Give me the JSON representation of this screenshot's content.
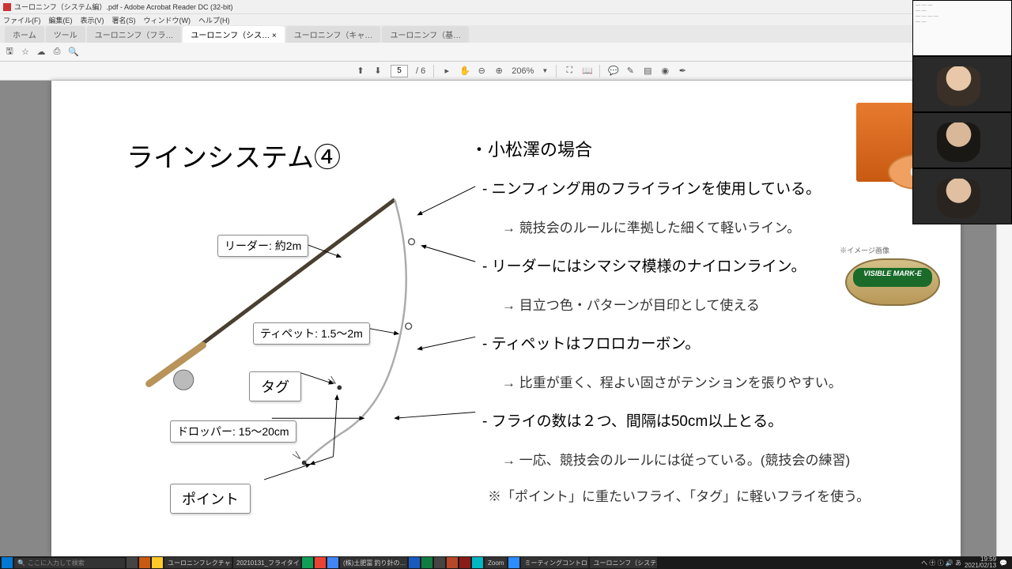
{
  "window": {
    "title": "ユーロニンフ（システム編）.pdf - Adobe Acrobat Reader DC (32-bit)"
  },
  "menu": {
    "file": "ファイル(F)",
    "edit": "編集(E)",
    "view": "表示(V)",
    "sign": "署名(S)",
    "window": "ウィンドウ(W)",
    "help": "ヘルプ(H)"
  },
  "tabs": {
    "home": "ホーム",
    "tools": "ツール",
    "t1": "ユーロニンフ（フラ…",
    "t2": "ユーロニンフ（シス… ×",
    "t3": "ユーロニンフ（キャ…",
    "t4": "ユーロニンフ（基…"
  },
  "toolbar": {
    "page_current": "5",
    "page_sep": "/ 6",
    "zoom": "206%"
  },
  "slide": {
    "title": "ラインシステム④",
    "heading": "・小松澤の場合",
    "l1": "- ニンフィング用のフライラインを使用している。",
    "s1": "→ 競技会のルールに準拠した細くて軽いライン。",
    "l2": "- リーダーにはシマシマ模様のナイロンライン。",
    "s2": "→ 目立つ色・パターンが目印として使える",
    "l3": "- ティペットはフロロカーボン。",
    "s3": "→ 比重が重く、程よい固さがテンションを張りやすい。",
    "l4": "- フライの数は２つ、間隔は50cm以上とる。",
    "s4": "→ 一応、競技会のルールには従っている。(競技会の練習)",
    "note": "※「ポイント」に重たいフライ、「タグ」に軽いフライを使う。",
    "lbl_leader": "リーダー: 約2m",
    "lbl_tippet": "ティペット: 1.5～2m",
    "lbl_tag": "タグ",
    "lbl_dropper": "ドロッパー: 15～20cm",
    "lbl_point": "ポイント",
    "img_caption": "※イメージ画像",
    "mark_label": "VISIBLE MARK-E"
  },
  "taskbar": {
    "search_placeholder": "ここに入力して検索",
    "items": [
      "ユーロニンフレクチャー",
      "20210131_フライタイ…",
      "",
      "(株)土肥冨 釣り針の…",
      "",
      "",
      "",
      "",
      "Zoom",
      "",
      "ミーティングコントロール",
      "ユーロニンフ（システム…"
    ],
    "time": "19:59",
    "date": "2021/02/13",
    "tray": "へ ㊉ ⓘ 🔊 あ"
  },
  "icons": {
    "star": "☆",
    "cloud": "☁",
    "print": "⎙",
    "search": "🔍",
    "up": "⬆",
    "down": "⬇",
    "hand": "✋",
    "minus": "⊖",
    "plus": "⊕",
    "fit": "⛶",
    "read": "📖",
    "comment": "💬",
    "pen": "✎",
    "hl": "▤",
    "stamp": "◉",
    "sig": "✒",
    "cursor": "▸",
    "save": "🖫"
  }
}
